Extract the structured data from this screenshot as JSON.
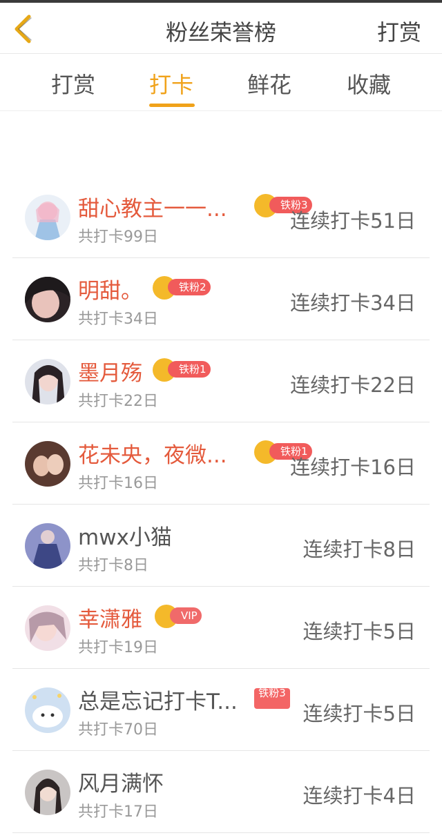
{
  "header": {
    "title": "粉丝荣誉榜",
    "right_action": "打赏"
  },
  "tabs": [
    {
      "label": "打赏",
      "active": false
    },
    {
      "label": "打卡",
      "active": true
    },
    {
      "label": "鲜花",
      "active": false
    },
    {
      "label": "收藏",
      "active": false
    }
  ],
  "colors": {
    "accent": "#f0a21a",
    "name_highlight": "#e45a3c",
    "badge_red": "#f15b5b",
    "crown_gold": "#f4b92a"
  },
  "rows": [
    {
      "name": "甜心教主一一...",
      "badge": "铁粉3",
      "total": "共打卡99日",
      "streak": "连续打卡51日",
      "highlight": true
    },
    {
      "name": "明甜。",
      "badge": "铁粉2",
      "total": "共打卡34日",
      "streak": "连续打卡34日",
      "highlight": true
    },
    {
      "name": "墨月殇",
      "badge": "铁粉1",
      "total": "共打卡22日",
      "streak": "连续打卡22日",
      "highlight": true
    },
    {
      "name": "花未央，夜微...",
      "badge": "铁粉1",
      "total": "共打卡16日",
      "streak": "连续打卡16日",
      "highlight": true
    },
    {
      "name": "mwx小猫",
      "badge": "",
      "total": "共打卡8日",
      "streak": "连续打卡8日",
      "highlight": false
    },
    {
      "name": "幸潇雅",
      "badge": "VIP",
      "total": "共打卡19日",
      "streak": "连续打卡5日",
      "highlight": true
    },
    {
      "name": "总是忘记打卡T...",
      "badge": "铁粉3",
      "total": "共打卡70日",
      "streak": "连续打卡5日",
      "highlight": false
    },
    {
      "name": "风月满怀",
      "badge": "",
      "total": "共打卡17日",
      "streak": "连续打卡4日",
      "highlight": false
    }
  ]
}
